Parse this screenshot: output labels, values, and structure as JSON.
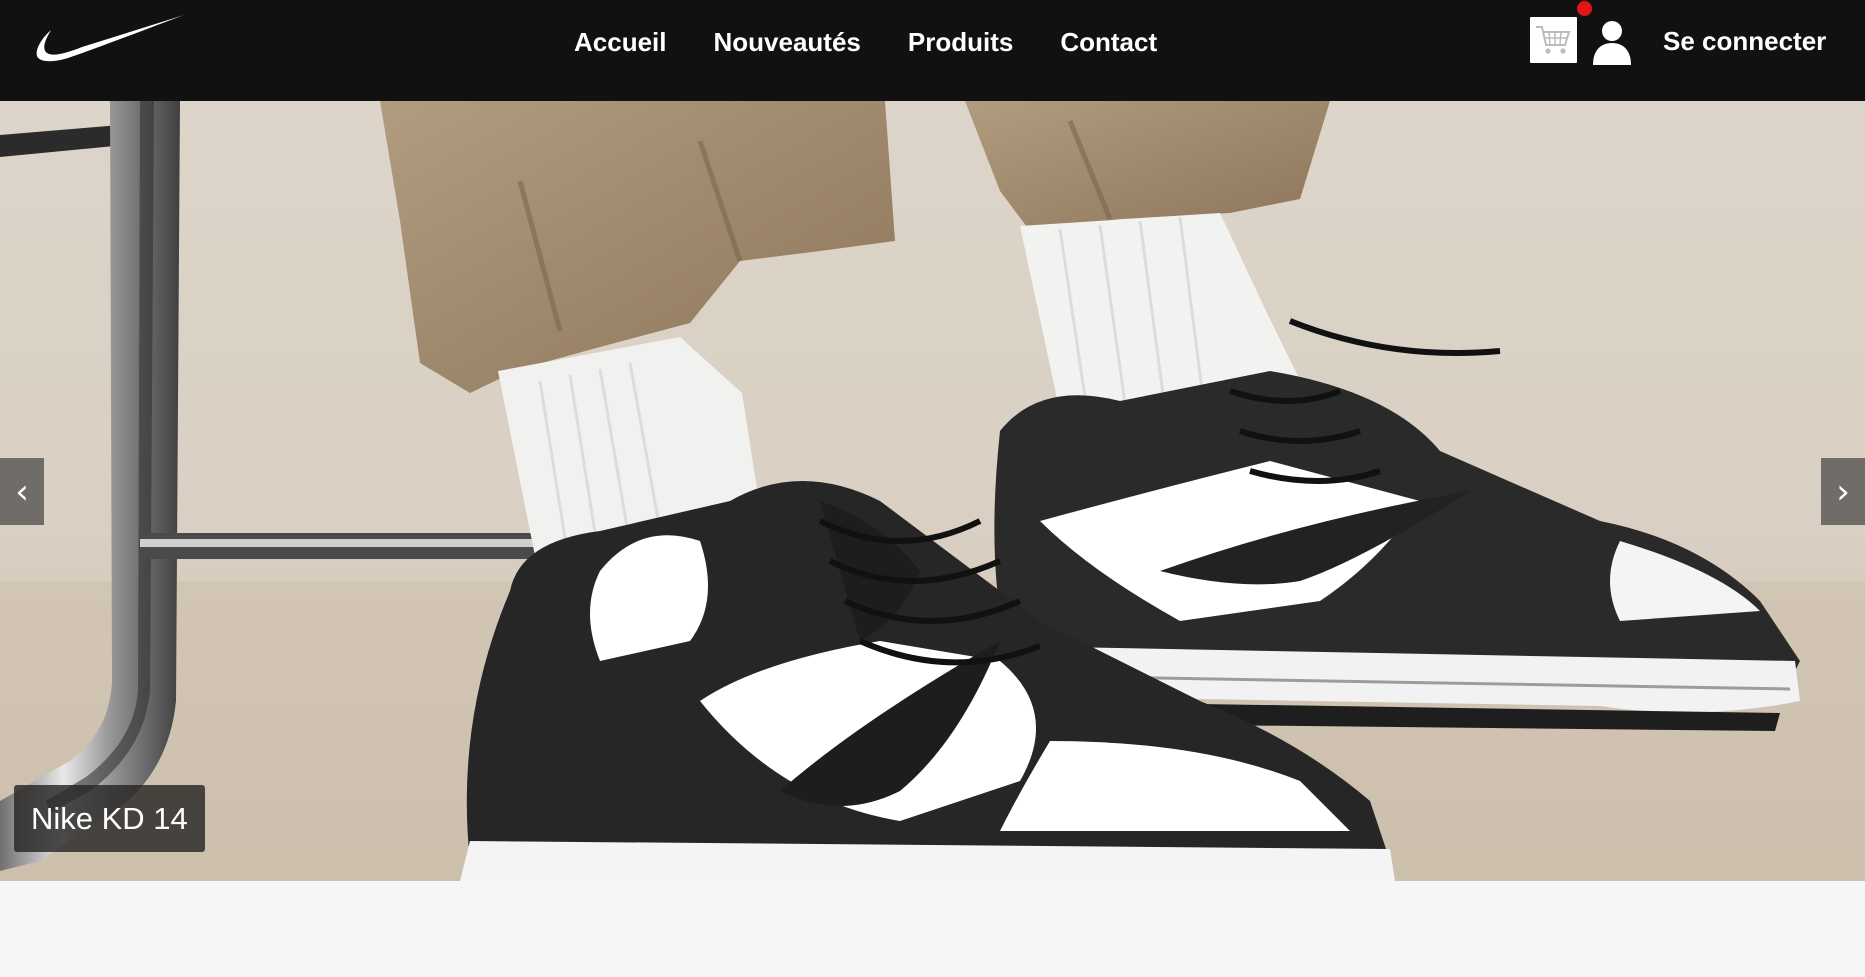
{
  "brand": {
    "logo_icon": "nike-swoosh-icon"
  },
  "nav": {
    "links": [
      {
        "label": "Accueil"
      },
      {
        "label": "Nouveautés"
      },
      {
        "label": "Produits"
      },
      {
        "label": "Contact"
      }
    ]
  },
  "header_actions": {
    "cart_icon": "cart-icon",
    "cart_badge_color": "#e41414",
    "user_icon": "user-icon",
    "login_label": "Se connecter"
  },
  "hero": {
    "image_icon": "sneaker-photo",
    "prev_label": "‹",
    "next_label": "›",
    "caption": "Nike KD 14"
  },
  "colors": {
    "header_bg": "#111111",
    "page_bg": "#f6f6f6"
  }
}
